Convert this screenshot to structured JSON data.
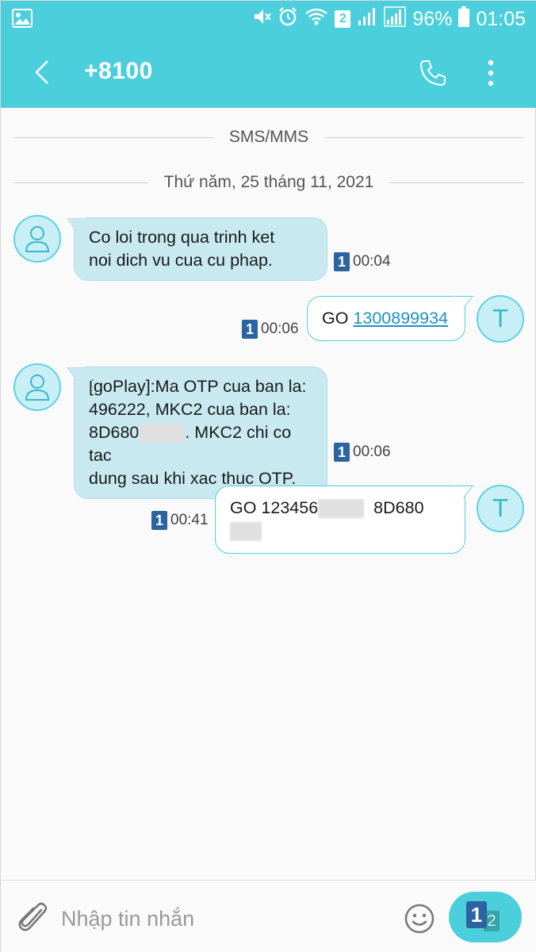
{
  "status_bar": {
    "sim_badge": "2",
    "battery": "96%",
    "time": "01:05"
  },
  "app_bar": {
    "title": "+8100"
  },
  "dividers": {
    "channel": "SMS/MMS",
    "date": "Thứ năm, 25 tháng 11, 2021"
  },
  "contact_avatar_letter": "T",
  "messages": [
    {
      "direction": "in",
      "lines": [
        "Co loi trong qua trinh ket",
        "noi dich vu cua cu phap."
      ],
      "sim": "1",
      "time": "00:04"
    },
    {
      "direction": "out",
      "prefix": "GO ",
      "link": "1300899934",
      "sim": "1",
      "time": "00:06"
    },
    {
      "direction": "in",
      "lines": [
        "[goPlay]:Ma OTP cua ban la:",
        "496222, MKC2 cua ban la:",
        "8D680",
        ". MKC2 chi co tac",
        "dung sau khi xac thuc OTP."
      ],
      "sim": "1",
      "time": "00:06"
    },
    {
      "direction": "out",
      "part1": "GO 123456",
      "part2": "8D680",
      "sim": "1",
      "time": "00:41"
    }
  ],
  "composer": {
    "placeholder": "Nhập tin nhắn",
    "send_sim_primary": "1",
    "send_sim_secondary": "2"
  },
  "colors": {
    "accent": "#4ccfdc",
    "incoming_bubble": "#c8e9f0",
    "sim_badge": "#2b64a0",
    "link": "#1e90c8"
  }
}
